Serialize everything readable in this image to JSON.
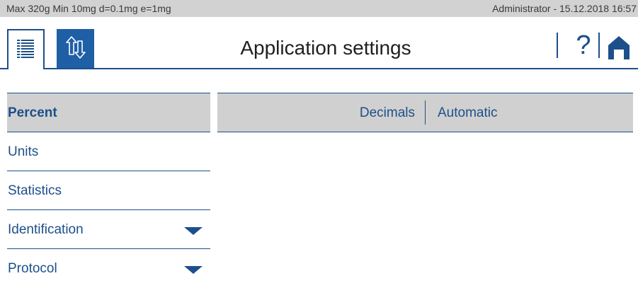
{
  "status_bar": {
    "scale_info": "Max 320g  Min 10mg  d=0.1mg  e=1mg",
    "user_datetime": "Administrator  -  15.12.2018 16:57"
  },
  "header": {
    "title": "Application settings",
    "tabs": [
      {
        "icon": "list-icon",
        "selected": true
      },
      {
        "icon": "transfer-arrows-icon",
        "selected": false
      }
    ],
    "help_label": "?",
    "home_icon": "home-icon"
  },
  "side_menu": {
    "items": [
      {
        "label": "Percent",
        "selected": true,
        "expandable": false
      },
      {
        "label": "Units",
        "selected": false,
        "expandable": false
      },
      {
        "label": "Statistics",
        "selected": false,
        "expandable": false
      },
      {
        "label": "Identification",
        "selected": false,
        "expandable": true
      },
      {
        "label": "Protocol",
        "selected": false,
        "expandable": true
      }
    ]
  },
  "settings": {
    "rows": [
      {
        "name": "Decimals",
        "value": "Automatic"
      }
    ]
  },
  "colors": {
    "accent": "#1d4f8a",
    "tab_active_fill": "#1f5fa6",
    "status_bar_bg": "#d2d2d2",
    "selected_bg": "#d0d0d0"
  }
}
